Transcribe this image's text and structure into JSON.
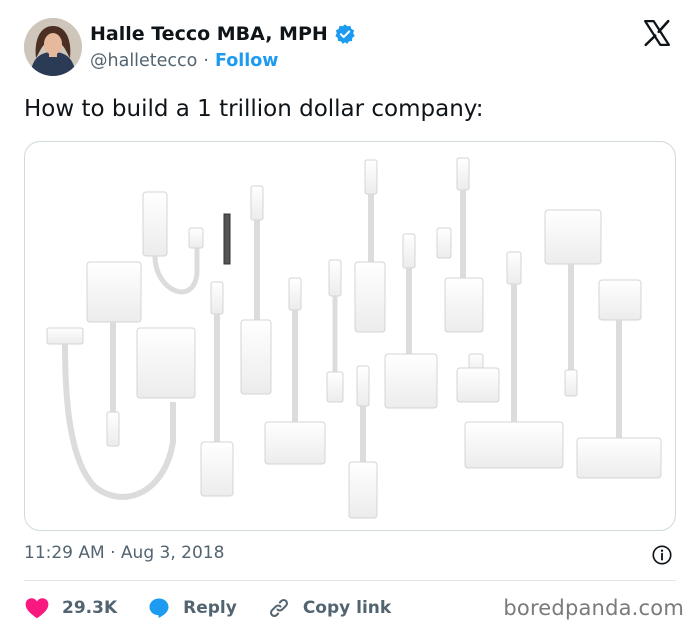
{
  "author": {
    "name": "Halle Tecco MBA, MPH",
    "handle": "@halletecco",
    "separator": "·",
    "follow_label": "Follow",
    "verified": true,
    "verified_color": "#1d9bf0"
  },
  "tweet": {
    "text": "How to build a 1 trillion dollar company:",
    "time": "11:29 AM",
    "separator": "·",
    "date": "Aug 3, 2018"
  },
  "actions": {
    "likes_count": "29.3K",
    "reply_label": "Reply",
    "copy_label": "Copy link",
    "like_color": "#f91880",
    "reply_color": "#1d9bf0"
  },
  "icons": {
    "platform": "x-logo-icon",
    "like": "heart-icon",
    "reply": "speech-bubble-icon",
    "copy": "link-icon",
    "info": "info-icon"
  },
  "watermark": "boredpanda.com"
}
